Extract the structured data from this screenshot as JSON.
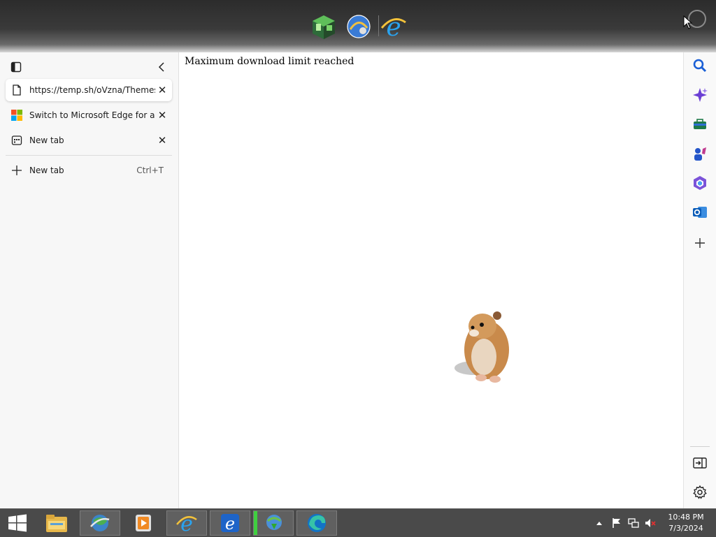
{
  "sidebar": {
    "tabs": [
      {
        "title": "https://temp.sh/oVzna/Themes.zip",
        "icon": "page-icon",
        "active": true
      },
      {
        "title": "Switch to Microsoft Edge for a better browsing experience",
        "icon": "microsoft-logo-icon",
        "active": false
      },
      {
        "title": "New tab",
        "icon": "new-tab-page-icon",
        "active": false
      }
    ],
    "new_tab_label": "New tab",
    "new_tab_shortcut": "Ctrl+T",
    "close_glyph": "✕"
  },
  "content": {
    "message": "Maximum download limit reached"
  },
  "rightbar": {
    "icons": [
      "search-icon",
      "copilot-icon",
      "tools-icon",
      "games-icon",
      "microsoft365-icon",
      "outlook-icon",
      "add-icon",
      "split-screen-icon",
      "settings-icon"
    ]
  },
  "taskbar": {
    "time": "10:48 PM",
    "date": "7/3/2024"
  },
  "colors": {
    "taskbar": "#4a4a4a",
    "sidebar_bg": "#f7f7f7",
    "accent_blue": "#1a73e8"
  }
}
